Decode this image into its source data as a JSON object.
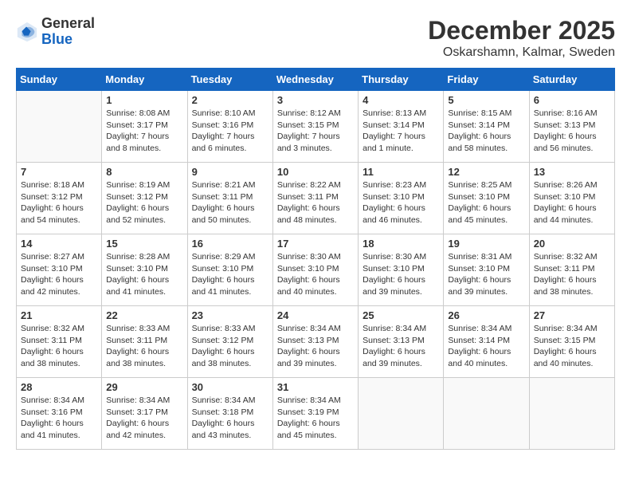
{
  "header": {
    "logo_general": "General",
    "logo_blue": "Blue",
    "month_title": "December 2025",
    "location": "Oskarshamn, Kalmar, Sweden"
  },
  "days_of_week": [
    "Sunday",
    "Monday",
    "Tuesday",
    "Wednesday",
    "Thursday",
    "Friday",
    "Saturday"
  ],
  "weeks": [
    [
      {
        "num": "",
        "sunrise": "",
        "sunset": "",
        "daylight": ""
      },
      {
        "num": "1",
        "sunrise": "Sunrise: 8:08 AM",
        "sunset": "Sunset: 3:17 PM",
        "daylight": "Daylight: 7 hours and 8 minutes."
      },
      {
        "num": "2",
        "sunrise": "Sunrise: 8:10 AM",
        "sunset": "Sunset: 3:16 PM",
        "daylight": "Daylight: 7 hours and 6 minutes."
      },
      {
        "num": "3",
        "sunrise": "Sunrise: 8:12 AM",
        "sunset": "Sunset: 3:15 PM",
        "daylight": "Daylight: 7 hours and 3 minutes."
      },
      {
        "num": "4",
        "sunrise": "Sunrise: 8:13 AM",
        "sunset": "Sunset: 3:14 PM",
        "daylight": "Daylight: 7 hours and 1 minute."
      },
      {
        "num": "5",
        "sunrise": "Sunrise: 8:15 AM",
        "sunset": "Sunset: 3:14 PM",
        "daylight": "Daylight: 6 hours and 58 minutes."
      },
      {
        "num": "6",
        "sunrise": "Sunrise: 8:16 AM",
        "sunset": "Sunset: 3:13 PM",
        "daylight": "Daylight: 6 hours and 56 minutes."
      }
    ],
    [
      {
        "num": "7",
        "sunrise": "Sunrise: 8:18 AM",
        "sunset": "Sunset: 3:12 PM",
        "daylight": "Daylight: 6 hours and 54 minutes."
      },
      {
        "num": "8",
        "sunrise": "Sunrise: 8:19 AM",
        "sunset": "Sunset: 3:12 PM",
        "daylight": "Daylight: 6 hours and 52 minutes."
      },
      {
        "num": "9",
        "sunrise": "Sunrise: 8:21 AM",
        "sunset": "Sunset: 3:11 PM",
        "daylight": "Daylight: 6 hours and 50 minutes."
      },
      {
        "num": "10",
        "sunrise": "Sunrise: 8:22 AM",
        "sunset": "Sunset: 3:11 PM",
        "daylight": "Daylight: 6 hours and 48 minutes."
      },
      {
        "num": "11",
        "sunrise": "Sunrise: 8:23 AM",
        "sunset": "Sunset: 3:10 PM",
        "daylight": "Daylight: 6 hours and 46 minutes."
      },
      {
        "num": "12",
        "sunrise": "Sunrise: 8:25 AM",
        "sunset": "Sunset: 3:10 PM",
        "daylight": "Daylight: 6 hours and 45 minutes."
      },
      {
        "num": "13",
        "sunrise": "Sunrise: 8:26 AM",
        "sunset": "Sunset: 3:10 PM",
        "daylight": "Daylight: 6 hours and 44 minutes."
      }
    ],
    [
      {
        "num": "14",
        "sunrise": "Sunrise: 8:27 AM",
        "sunset": "Sunset: 3:10 PM",
        "daylight": "Daylight: 6 hours and 42 minutes."
      },
      {
        "num": "15",
        "sunrise": "Sunrise: 8:28 AM",
        "sunset": "Sunset: 3:10 PM",
        "daylight": "Daylight: 6 hours and 41 minutes."
      },
      {
        "num": "16",
        "sunrise": "Sunrise: 8:29 AM",
        "sunset": "Sunset: 3:10 PM",
        "daylight": "Daylight: 6 hours and 41 minutes."
      },
      {
        "num": "17",
        "sunrise": "Sunrise: 8:30 AM",
        "sunset": "Sunset: 3:10 PM",
        "daylight": "Daylight: 6 hours and 40 minutes."
      },
      {
        "num": "18",
        "sunrise": "Sunrise: 8:30 AM",
        "sunset": "Sunset: 3:10 PM",
        "daylight": "Daylight: 6 hours and 39 minutes."
      },
      {
        "num": "19",
        "sunrise": "Sunrise: 8:31 AM",
        "sunset": "Sunset: 3:10 PM",
        "daylight": "Daylight: 6 hours and 39 minutes."
      },
      {
        "num": "20",
        "sunrise": "Sunrise: 8:32 AM",
        "sunset": "Sunset: 3:11 PM",
        "daylight": "Daylight: 6 hours and 38 minutes."
      }
    ],
    [
      {
        "num": "21",
        "sunrise": "Sunrise: 8:32 AM",
        "sunset": "Sunset: 3:11 PM",
        "daylight": "Daylight: 6 hours and 38 minutes."
      },
      {
        "num": "22",
        "sunrise": "Sunrise: 8:33 AM",
        "sunset": "Sunset: 3:11 PM",
        "daylight": "Daylight: 6 hours and 38 minutes."
      },
      {
        "num": "23",
        "sunrise": "Sunrise: 8:33 AM",
        "sunset": "Sunset: 3:12 PM",
        "daylight": "Daylight: 6 hours and 38 minutes."
      },
      {
        "num": "24",
        "sunrise": "Sunrise: 8:34 AM",
        "sunset": "Sunset: 3:13 PM",
        "daylight": "Daylight: 6 hours and 39 minutes."
      },
      {
        "num": "25",
        "sunrise": "Sunrise: 8:34 AM",
        "sunset": "Sunset: 3:13 PM",
        "daylight": "Daylight: 6 hours and 39 minutes."
      },
      {
        "num": "26",
        "sunrise": "Sunrise: 8:34 AM",
        "sunset": "Sunset: 3:14 PM",
        "daylight": "Daylight: 6 hours and 40 minutes."
      },
      {
        "num": "27",
        "sunrise": "Sunrise: 8:34 AM",
        "sunset": "Sunset: 3:15 PM",
        "daylight": "Daylight: 6 hours and 40 minutes."
      }
    ],
    [
      {
        "num": "28",
        "sunrise": "Sunrise: 8:34 AM",
        "sunset": "Sunset: 3:16 PM",
        "daylight": "Daylight: 6 hours and 41 minutes."
      },
      {
        "num": "29",
        "sunrise": "Sunrise: 8:34 AM",
        "sunset": "Sunset: 3:17 PM",
        "daylight": "Daylight: 6 hours and 42 minutes."
      },
      {
        "num": "30",
        "sunrise": "Sunrise: 8:34 AM",
        "sunset": "Sunset: 3:18 PM",
        "daylight": "Daylight: 6 hours and 43 minutes."
      },
      {
        "num": "31",
        "sunrise": "Sunrise: 8:34 AM",
        "sunset": "Sunset: 3:19 PM",
        "daylight": "Daylight: 6 hours and 45 minutes."
      },
      {
        "num": "",
        "sunrise": "",
        "sunset": "",
        "daylight": ""
      },
      {
        "num": "",
        "sunrise": "",
        "sunset": "",
        "daylight": ""
      },
      {
        "num": "",
        "sunrise": "",
        "sunset": "",
        "daylight": ""
      }
    ]
  ]
}
